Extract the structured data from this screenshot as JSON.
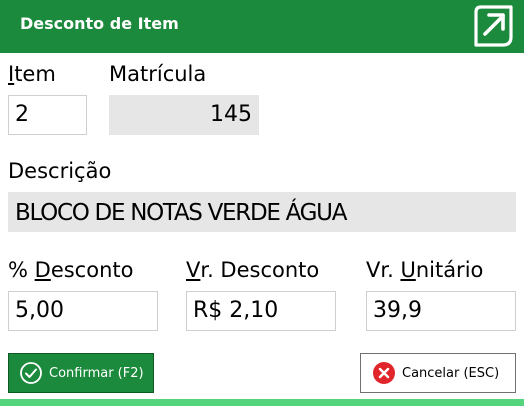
{
  "window": {
    "title": "Desconto de Item"
  },
  "item": {
    "label_accel": "I",
    "label_rest": "tem",
    "value": "2"
  },
  "matricula": {
    "label": "Matrícula",
    "value": "145"
  },
  "descricao": {
    "label": "Descrição",
    "value": "BLOCO DE NOTAS VERDE ÁGUA"
  },
  "pct_desconto": {
    "label_pre": "% ",
    "label_accel": "D",
    "label_rest": "esconto",
    "value": "5,00"
  },
  "vr_desconto": {
    "label_accel": "V",
    "label_rest": "r. Desconto",
    "value": "R$ 2,10"
  },
  "vr_unitario": {
    "label_pre": "Vr. ",
    "label_accel": "U",
    "label_rest": "nitário",
    "value": "39,9"
  },
  "buttons": {
    "confirm": "Confirmar (F2)",
    "cancel": "Cancelar (ESC)"
  },
  "icons": {
    "brand": "arrow-up-right-icon",
    "confirm": "check-circle-icon",
    "cancel": "x-circle-icon"
  },
  "colors": {
    "primary": "#1c8a3c",
    "readonly_bg": "#e6e6e6",
    "cancel_red": "#e0262b",
    "footer_bar": "#54d47c"
  }
}
